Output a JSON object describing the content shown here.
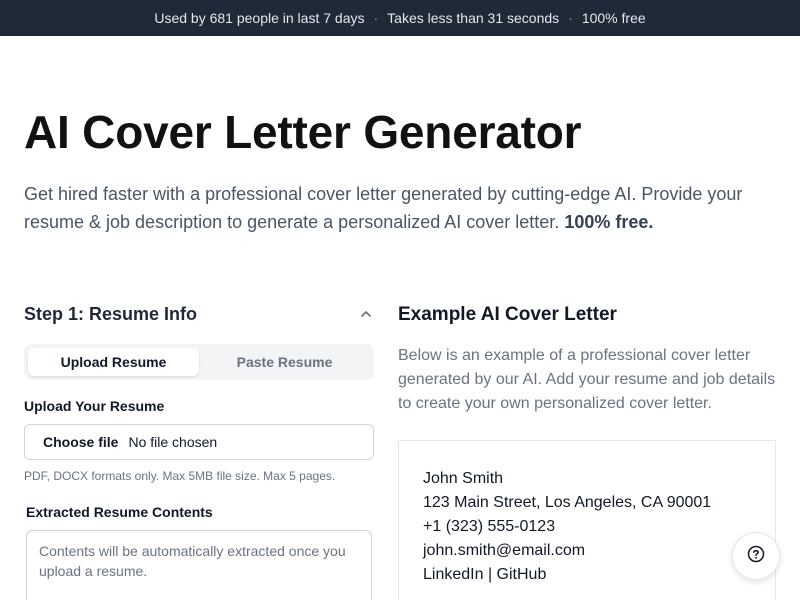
{
  "banner": {
    "usage": "Used by 681 people in last 7 days",
    "speed": "Takes less than 31 seconds",
    "price": "100% free",
    "separator": "·"
  },
  "hero": {
    "title": "AI Cover Letter Generator",
    "subtitle": "Get hired faster with a professional cover letter generated by cutting-edge AI. Provide your resume & job description to generate a personalized AI cover letter.",
    "subtitle_emphasis": "100% free."
  },
  "step1": {
    "title": "Step 1: Resume Info",
    "toggle_icon": "chevron-up-icon",
    "tabs": [
      {
        "label": "Upload Resume",
        "active": true
      },
      {
        "label": "Paste Resume",
        "active": false
      }
    ],
    "upload_label": "Upload Your Resume",
    "file_button": "Choose file",
    "file_status": "No file chosen",
    "hint": "PDF, DOCX formats only. Max 5MB file size. Max 5 pages.",
    "extracted_label": "Extracted Resume Contents",
    "extracted_placeholder": "Contents will be automatically extracted once you upload a resume."
  },
  "example": {
    "title": "Example AI Cover Letter",
    "description": "Below is an example of a professional cover letter generated by our AI. Add your resume and job details to create your own personalized cover letter.",
    "letter_lines": [
      "John Smith",
      "123 Main Street, Los Angeles, CA 90001",
      "+1 (323) 555-0123",
      "john.smith@email.com",
      "LinkedIn | GitHub"
    ]
  },
  "help": {
    "icon": "help-icon"
  },
  "colors": {
    "banner_bg": "#1f2937",
    "text_primary": "#111827",
    "text_muted": "#6b7280",
    "border": "#d1d5db"
  }
}
